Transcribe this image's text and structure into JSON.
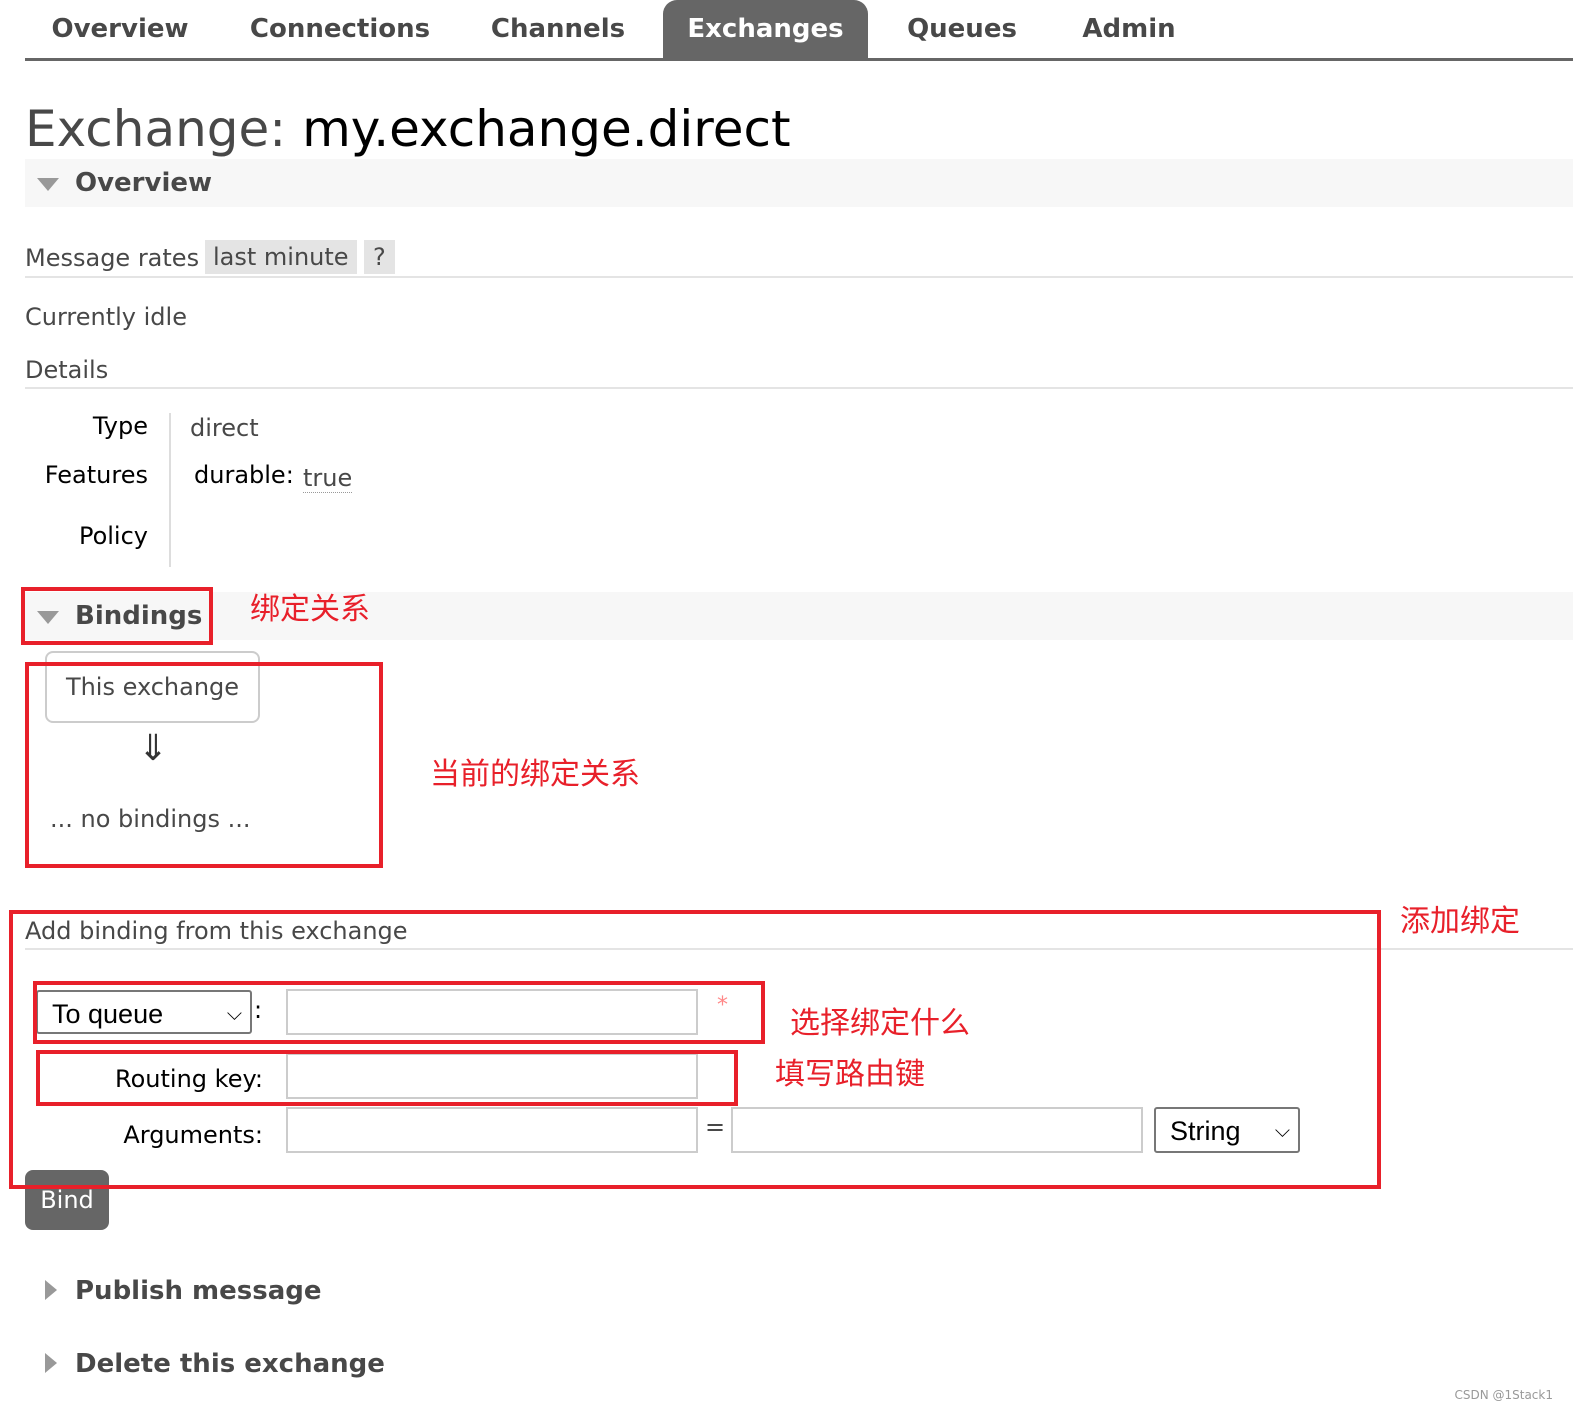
{
  "nav": {
    "tabs": [
      {
        "label": "Overview"
      },
      {
        "label": "Connections"
      },
      {
        "label": "Channels"
      },
      {
        "label": "Exchanges",
        "active": true
      },
      {
        "label": "Queues"
      },
      {
        "label": "Admin"
      }
    ]
  },
  "page": {
    "title_prefix": "Exchange:",
    "title_name": "my.exchange.direct"
  },
  "overview": {
    "heading": "Overview",
    "message_rates_label": "Message rates",
    "rate_period": "last minute",
    "help": "?",
    "status": "Currently idle",
    "details_label": "Details",
    "details": {
      "type_label": "Type",
      "type_value": "direct",
      "features_label": "Features",
      "durable_label": "durable:",
      "durable_value": "true",
      "policy_label": "Policy"
    }
  },
  "bindings": {
    "heading": "Bindings",
    "this_exchange": "This exchange",
    "arrow": "⇓",
    "none": "... no bindings ..."
  },
  "add_binding": {
    "heading": "Add binding from this exchange",
    "destination_type": "To queue",
    "colon": ":",
    "required_mark": "*",
    "destination_value": "",
    "routing_key_label": "Routing key:",
    "routing_key_value": "",
    "arguments_label": "Arguments:",
    "arg_key": "",
    "equals": "=",
    "arg_value": "",
    "arg_type": "String",
    "bind_label": "Bind"
  },
  "publish": {
    "heading": "Publish message"
  },
  "delete": {
    "heading": "Delete this exchange"
  },
  "annotations": {
    "bindings": "绑定关系",
    "current": "当前的绑定关系",
    "add": "添加绑定",
    "choose": "选择绑定什么",
    "routing": "填写路由键"
  },
  "watermark": "CSDN @1Stack1",
  "colors": {
    "accent": "#666666",
    "annotation": "#e8202a"
  }
}
